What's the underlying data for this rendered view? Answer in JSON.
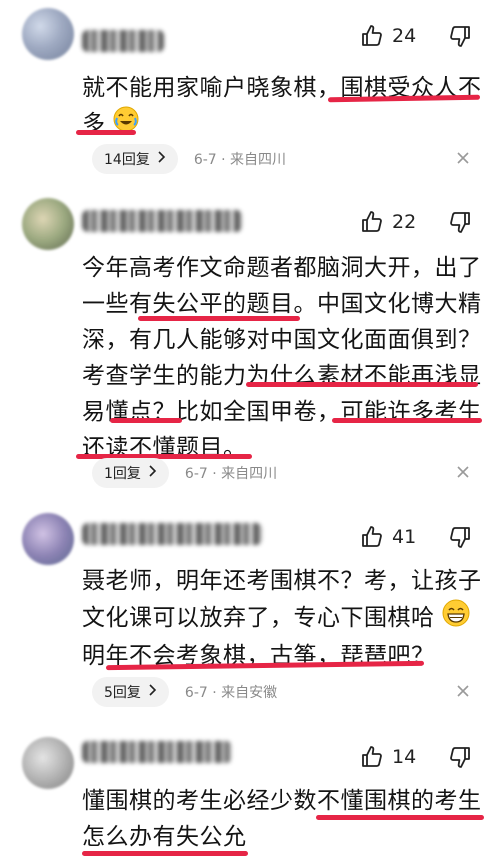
{
  "comments": [
    {
      "likes": "24",
      "text": "就不能用家喻户晓象棋，围棋受众人不多",
      "line1": "就不能用家喻户晓象棋，围棋受众人不",
      "line2": "多",
      "replies": "14回复",
      "meta": "6-7 · 来自四川"
    },
    {
      "likes": "22",
      "lines": [
        "今年高考作文命题者都脑洞大开，出了",
        "一些有失公平的题目。中国文化博大精",
        "深，有几人能够对中国文化面面俱到？",
        "考查学生的能力为什么素材不能再浅显",
        "易懂点？比如全国甲卷，可能许多考生",
        "还读不懂题目。"
      ],
      "replies": "1回复",
      "meta": "6-7 · 来自四川"
    },
    {
      "likes": "41",
      "lines": [
        "聂老师，明年还考围棋不？考，让孩子",
        "文化课可以放弃了，专心下围棋哈",
        "明年不会考象棋，古筝，琵琶吧？"
      ],
      "replies": "5回复",
      "meta": "6-7 · 来自安徽"
    },
    {
      "likes": "14",
      "lines": [
        "懂围棋的考生必经少数不懂围棋的考生",
        "怎么办有失公允"
      ]
    }
  ],
  "icons": {
    "like": "thumbs-up-icon",
    "dislike": "thumbs-down-icon",
    "close": "close-icon",
    "chevron": "chevron-right-icon"
  },
  "colors": {
    "highlight_underline": "#e62546",
    "meta_text": "#8a8a8a",
    "pill_bg": "#f2f2f2"
  }
}
